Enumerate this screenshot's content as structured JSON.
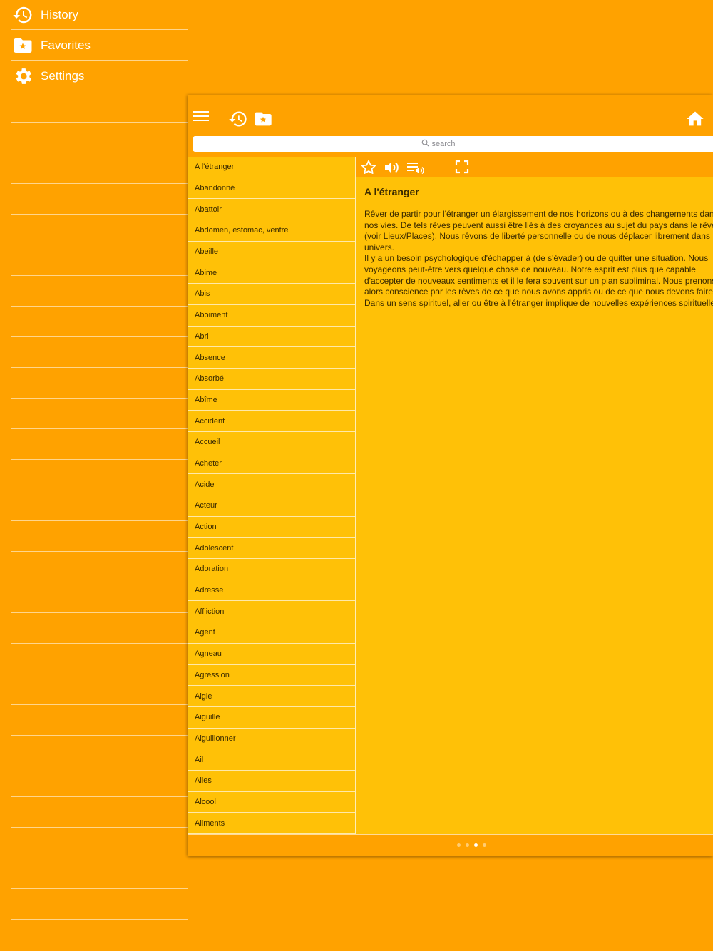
{
  "sidebar": {
    "items": [
      {
        "label": "History",
        "icon": "history-icon"
      },
      {
        "label": "Favorites",
        "icon": "favorites-folder-icon"
      },
      {
        "label": "Settings",
        "icon": "gear-icon"
      }
    ]
  },
  "search": {
    "placeholder": "search"
  },
  "words": [
    "A l'étranger",
    "Abandonné",
    "Abattoir",
    "Abdomen, estomac, ventre",
    "Abeille",
    "Abime",
    "Abis",
    "Aboiment",
    "Abri",
    "Absence",
    "Absorbé",
    "Abîme",
    "Accident",
    "Accueil",
    "Acheter",
    "Acide",
    "Acteur",
    "Action",
    "Adolescent",
    "Adoration",
    "Adresse",
    "Affliction",
    "Agent",
    "Agneau",
    "Agression",
    "Aigle",
    "Aiguille",
    "Aiguillonner",
    "Ail",
    "Ailes",
    "Alcool",
    "Aliments"
  ],
  "detail": {
    "title": "A l'étranger",
    "body": "Rêver de partir pour l'étranger un élargissement de nos horizons ou à des changements dans\nnos vies. De tels rêves peuvent aussi être liés à des croyances au sujet du pays dans le rêve\n(voir Lieux/Places). Nous rêvons de liberté personnelle ou de nous déplacer librement dans notre\nunivers.\nIl y a un besoin psychologique d'échapper à (de s'évader) ou de quitter une situation. Nous\nvoyageons peut-être vers quelque chose de nouveau. Notre esprit est plus que capable\nd'accepter de nouveaux sentiments et il le fera souvent sur un plan subliminal. Nous prenons\nalors conscience par les rêves de ce que nous avons appris ou de ce que nous devons faire.\nDans un sens spirituel, aller ou être à l'étranger implique de nouvelles expériences spirituelles."
  },
  "pager": {
    "count": 4,
    "active": 2
  },
  "colors": {
    "background": "#FFA200",
    "panel": "#FFC107",
    "text": "#3A2A00",
    "accent": "#FFFFFF"
  }
}
